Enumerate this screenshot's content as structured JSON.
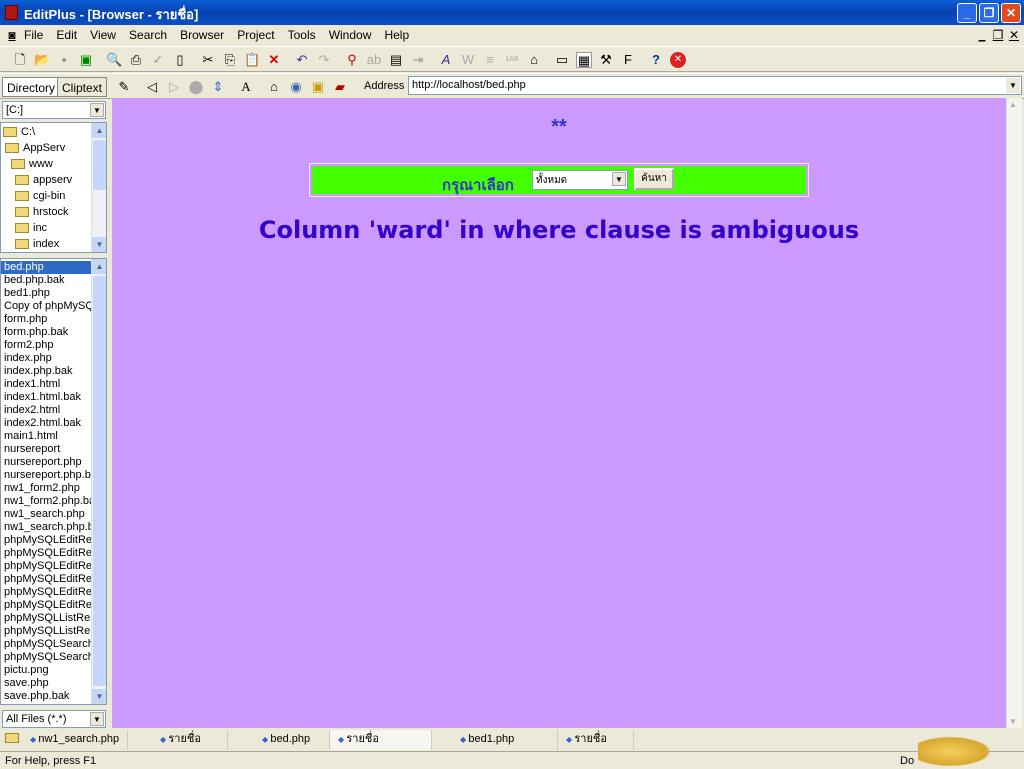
{
  "window": {
    "title": "EditPlus - [Browser - รายชื่อ]"
  },
  "menu": [
    "File",
    "Edit",
    "View",
    "Search",
    "Browser",
    "Project",
    "Tools",
    "Window",
    "Help"
  ],
  "panel_tabs": [
    "Directory",
    "Cliptext"
  ],
  "address": {
    "label": "Address",
    "value": "http://localhost/bed.php"
  },
  "drive": "[C:]",
  "dirs": [
    "C:\\",
    "AppServ",
    "www",
    "appserv",
    "cgi-bin",
    "hrstock",
    "inc",
    "index"
  ],
  "files": [
    "bed.php",
    "bed.php.bak",
    "bed1.php",
    "Copy of phpMySQ",
    "form.php",
    "form.php.bak",
    "form2.php",
    "index.php",
    "index.php.bak",
    "index1.html",
    "index1.html.bak",
    "index2.html",
    "index2.html.bak",
    "main1.html",
    "nursereport",
    "nursereport.php",
    "nursereport.php.ba",
    "nw1_form2.php",
    "nw1_form2.php.ba",
    "nw1_search.php",
    "nw1_search.php.b",
    "phpMySQLEditRe",
    "phpMySQLEditRe",
    "phpMySQLEditRe",
    "phpMySQLEditRe",
    "phpMySQLEditRe",
    "phpMySQLEditRe",
    "phpMySQLListRe",
    "phpMySQLListRe",
    "phpMySQLSearch",
    "phpMySQLSearch",
    "pictu.png",
    "save.php",
    "save.php.bak"
  ],
  "filter": "All Files (*.*)",
  "page": {
    "stars": "**",
    "select_label": "กรุณาเลือก",
    "select_value": "ทั้งหมด",
    "search_button": "ค้นหา",
    "error": "Column 'ward' in where clause is ambiguous"
  },
  "doc_tabs": [
    "nw1_search.php",
    "รายชื่อ",
    "bed.php",
    "รายชื่อ",
    "bed1.php",
    "รายชื่อ"
  ],
  "status": {
    "help": "For Help, press F1",
    "right": "Do"
  },
  "colors": {
    "page_bg": "#cc99ff",
    "form_bg": "#44ff00",
    "text": "#3300cc"
  }
}
